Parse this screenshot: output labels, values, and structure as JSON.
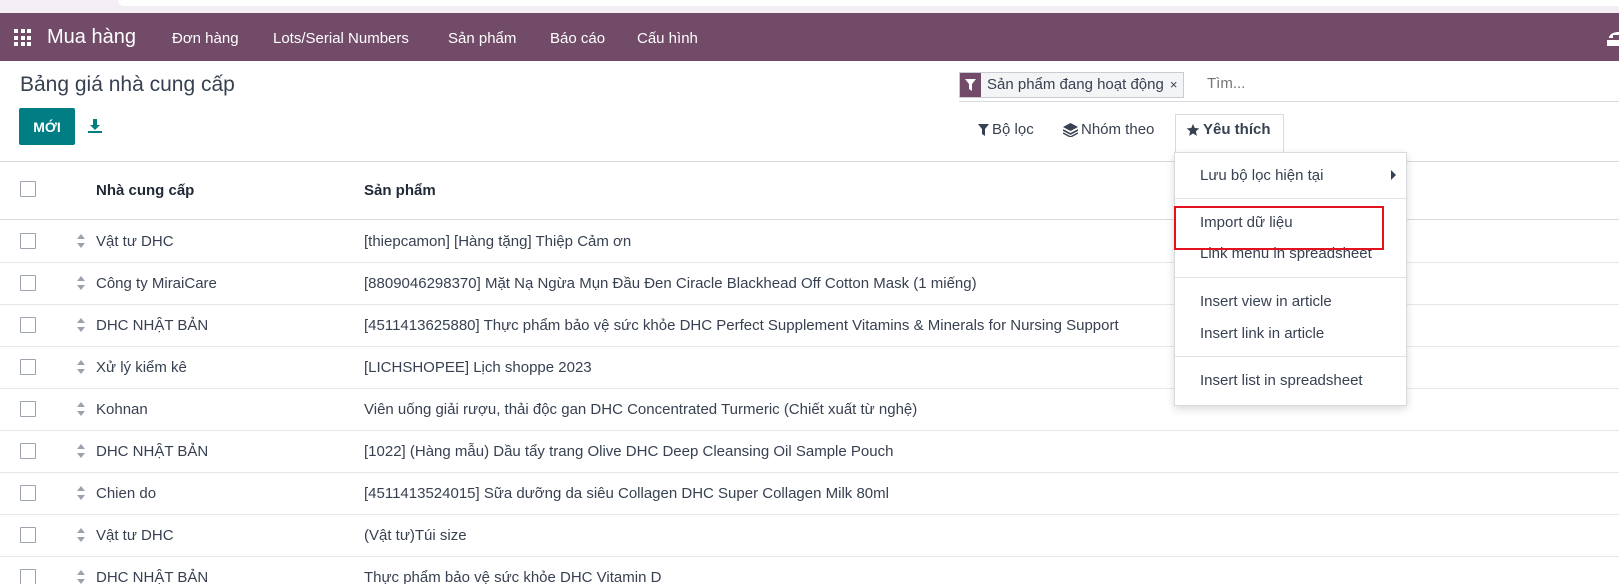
{
  "navbar": {
    "app_name": "Mua hàng",
    "menu": [
      "Đơn hàng",
      "Lots/Serial Numbers",
      "Sản phẩm",
      "Báo cáo",
      "Cấu hình"
    ],
    "bg_color": "#714b67"
  },
  "page": {
    "title": "Bảng giá nhà cung cấp",
    "new_button": "MỚI"
  },
  "search": {
    "facet_label": "Sản phẩm đang hoạt động",
    "facet_close": "×",
    "placeholder": "Tìm..."
  },
  "controls": {
    "filters": "Bộ lọc",
    "group_by": "Nhóm theo",
    "favorites": "Yêu thích"
  },
  "favorites_menu": {
    "save_current": "Lưu bộ lọc hiện tại",
    "import": "Import dữ liệu",
    "link_menu": "Link menu in spreadsheet",
    "insert_view": "Insert view in article",
    "insert_link": "Insert link in article",
    "insert_list": "Insert list in spreadsheet"
  },
  "table": {
    "columns": [
      "Nhà cung cấp",
      "Sản phẩm"
    ],
    "rows": [
      {
        "supplier": "Vật tư DHC",
        "product": "[thiepcamon] [Hàng tặng] Thiệp Cảm ơn"
      },
      {
        "supplier": "Công ty MiraiCare",
        "product": "[8809046298370] Mặt Nạ Ngừa Mụn Đầu Đen Ciracle Blackhead Off Cotton Mask (1 miếng)"
      },
      {
        "supplier": "DHC NHẬT BẢN",
        "product": "[4511413625880] Thực phẩm bảo vệ sức khỏe DHC Perfect Supplement Vitamins & Minerals for Nursing Support"
      },
      {
        "supplier": "Xử lý kiểm kê",
        "product": "[LICHSHOPEE] Lịch shoppe 2023"
      },
      {
        "supplier": "Kohnan",
        "product": "Viên uống giải rượu, thải độc gan DHC Concentrated Turmeric (Chiết xuất từ nghệ)"
      },
      {
        "supplier": "DHC NHẬT BẢN",
        "product": "[1022] (Hàng mẫu) Dầu tẩy trang Olive DHC Deep Cleansing Oil Sample Pouch"
      },
      {
        "supplier": "Chien do",
        "product": "[4511413524015] Sữa dưỡng da siêu Collagen DHC Super Collagen Milk 80ml"
      },
      {
        "supplier": "Vật tư DHC",
        "product": "(Vật tư)Túi size"
      },
      {
        "supplier": "DHC NHẬT BẢN",
        "product": "Thực phẩm bảo vệ sức khỏe DHC Vitamin D"
      }
    ]
  },
  "colors": {
    "primary": "#017e84",
    "highlight": "#e3121f"
  }
}
